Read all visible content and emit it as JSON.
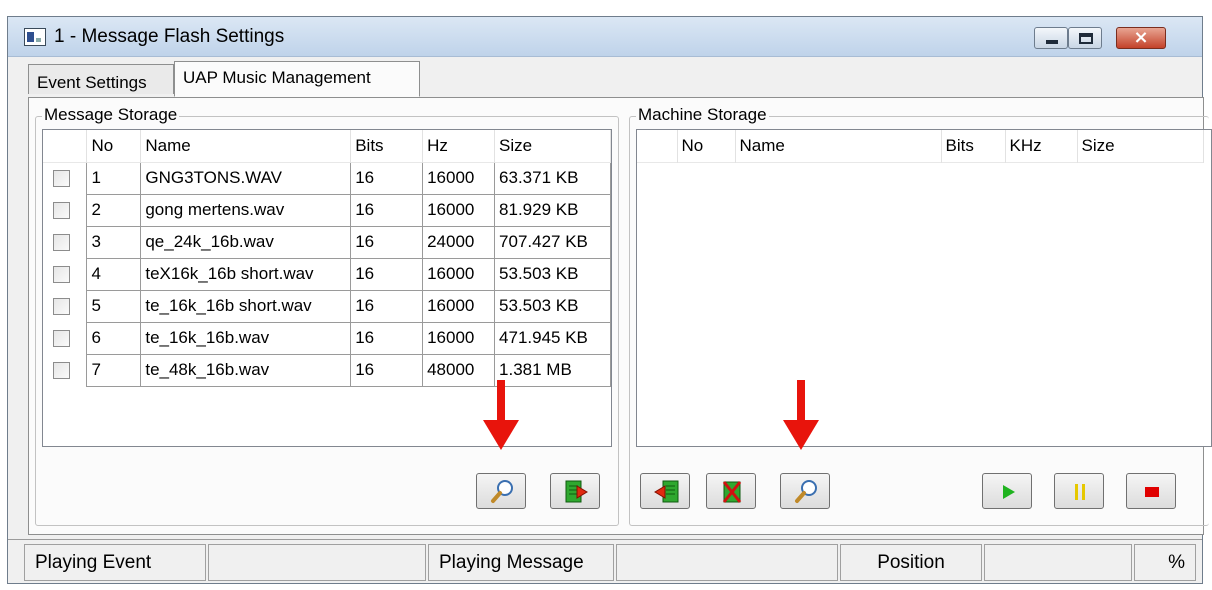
{
  "window": {
    "title": "1 - Message Flash Settings",
    "controls": {
      "minimize": "minimize-icon",
      "maximize": "maximize-icon",
      "close": "×"
    }
  },
  "tabs": [
    {
      "label": "Event Settings",
      "selected": false
    },
    {
      "label": "UAP Music Management",
      "selected": true
    }
  ],
  "message_storage": {
    "label": "Message Storage",
    "columns": [
      "No",
      "Name",
      "Bits",
      "Hz",
      "Size"
    ],
    "rows": [
      {
        "no": "1",
        "name": "GNG3TONS.WAV",
        "bits": "16",
        "hz": "16000",
        "size": "63.371 KB"
      },
      {
        "no": "2",
        "name": "gong mertens.wav",
        "bits": "16",
        "hz": "16000",
        "size": "81.929 KB"
      },
      {
        "no": "3",
        "name": "qe_24k_16b.wav",
        "bits": "16",
        "hz": "24000",
        "size": "707.427 KB"
      },
      {
        "no": "4",
        "name": "teX16k_16b short.wav",
        "bits": "16",
        "hz": "16000",
        "size": "53.503 KB"
      },
      {
        "no": "5",
        "name": "te_16k_16b short.wav",
        "bits": "16",
        "hz": "16000",
        "size": "53.503 KB"
      },
      {
        "no": "6",
        "name": "te_16k_16b.wav",
        "bits": "16",
        "hz": "16000",
        "size": "471.945 KB"
      },
      {
        "no": "7",
        "name": "te_48k_16b.wav",
        "bits": "16",
        "hz": "48000",
        "size": "1.381 MB"
      }
    ],
    "buttons": [
      "search-icon",
      "transfer-to-machine-icon"
    ]
  },
  "machine_storage": {
    "label": "Machine Storage",
    "columns": [
      "No",
      "Name",
      "Bits",
      "KHz",
      "Size"
    ],
    "rows": [],
    "buttons": [
      "transfer-to-message-icon",
      "delete-icon",
      "search-icon",
      "play-icon",
      "pause-icon",
      "stop-icon"
    ]
  },
  "status_bar": {
    "playing_event_label": "Playing Event",
    "playing_event_value": "",
    "playing_message_label": "Playing Message",
    "playing_message_value": "",
    "position_label": "Position",
    "position_value": "",
    "percent_label": "%"
  },
  "colors": {
    "annotation_arrow": "#e8140c",
    "play": "#1fb31f",
    "pause": "#e6c800",
    "stop": "#e00000",
    "store_green": "#20a020"
  }
}
